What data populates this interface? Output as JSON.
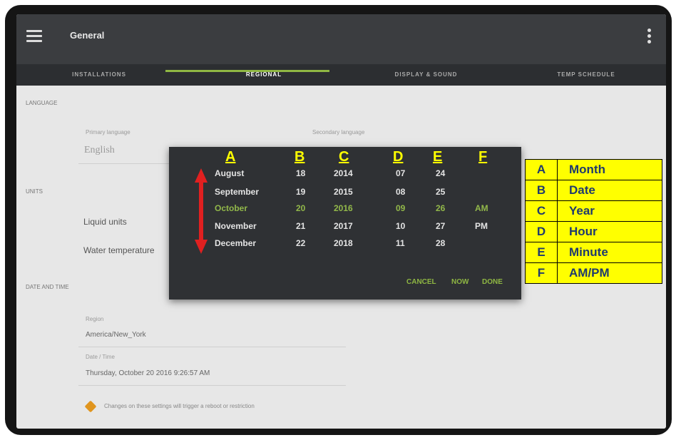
{
  "app": {
    "title": "General"
  },
  "tabs": [
    {
      "label": "INSTALLATIONS"
    },
    {
      "label": "REGIONAL"
    },
    {
      "label": "DISPLAY & SOUND"
    },
    {
      "label": "TEMP SCHEDULE"
    }
  ],
  "sections": {
    "language": "LANGUAGE",
    "units": "UNITS",
    "date_time": "DATE AND TIME"
  },
  "language": {
    "primary_label": "Primary language",
    "primary_value": "English",
    "secondary_label": "Secondary language"
  },
  "units": {
    "liquid": "Liquid units",
    "water_temp": "Water temperature"
  },
  "datetime": {
    "region_label": "Region",
    "region_value": "America/New_York",
    "datetime_label": "Date / Time",
    "datetime_value": "Thursday, October 20 2016 9:26:57 AM"
  },
  "warning": "Changes on these settings will trigger a reboot or restriction",
  "picker": {
    "headers": [
      "A",
      "B",
      "C",
      "D",
      "E",
      "F"
    ],
    "rows": [
      [
        "August",
        "18",
        "2014",
        "07",
        "24",
        ""
      ],
      [
        "September",
        "19",
        "2015",
        "08",
        "25",
        ""
      ],
      [
        "October",
        "20",
        "2016",
        "09",
        "26",
        "AM"
      ],
      [
        "November",
        "21",
        "2017",
        "10",
        "27",
        "PM"
      ],
      [
        "December",
        "22",
        "2018",
        "11",
        "28",
        ""
      ]
    ],
    "selected_row": 2,
    "buttons": {
      "cancel": "CANCEL",
      "now": "NOW",
      "done": "DONE"
    }
  },
  "legend": [
    {
      "key": "A",
      "value": "Month"
    },
    {
      "key": "B",
      "value": "Date"
    },
    {
      "key": "C",
      "value": "Year"
    },
    {
      "key": "D",
      "value": "Hour"
    },
    {
      "key": "E",
      "value": "Minute"
    },
    {
      "key": "F",
      "value": "AM/PM"
    }
  ],
  "colors": {
    "accent_green": "#8fb743",
    "annotation_yellow": "#ffff00",
    "arrow_red": "#e02020",
    "legend_text": "#1f3a6e"
  }
}
